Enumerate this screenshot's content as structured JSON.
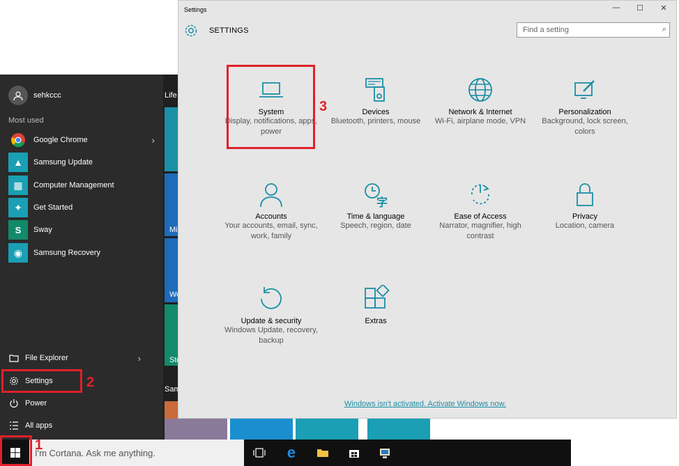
{
  "start_menu": {
    "user_name": "sehkccc",
    "most_used_label": "Most used",
    "life_label": "Life",
    "items": [
      {
        "label": "Google Chrome",
        "icon": "chrome-icon"
      },
      {
        "label": "Samsung Update",
        "icon": "samsung-update-icon"
      },
      {
        "label": "Computer Management",
        "icon": "computer-management-icon"
      },
      {
        "label": "Get Started",
        "icon": "lightbulb-icon"
      },
      {
        "label": "Sway",
        "icon": "sway-icon"
      },
      {
        "label": "Samsung Recovery",
        "icon": "samsung-recovery-icon"
      }
    ],
    "bottom": {
      "file_explorer": "File Explorer",
      "settings": "Settings",
      "power": "Power",
      "all_apps": "All apps"
    },
    "tile_labels": [
      "Mi",
      "We",
      "Sto",
      "Sam"
    ]
  },
  "taskbar": {
    "search_placeholder": "I'm Cortana. Ask me anything."
  },
  "settings_window": {
    "title": "Settings",
    "header": "SETTINGS",
    "find_placeholder": "Find a setting",
    "categories": [
      {
        "name": "System",
        "desc": "Display, notifications, apps, power",
        "icon": "laptop-icon"
      },
      {
        "name": "Devices",
        "desc": "Bluetooth, printers, mouse",
        "icon": "devices-icon"
      },
      {
        "name": "Network & Internet",
        "desc": "Wi-Fi, airplane mode, VPN",
        "icon": "globe-icon"
      },
      {
        "name": "Personalization",
        "desc": "Background, lock screen, colors",
        "icon": "paint-icon"
      },
      {
        "name": "Accounts",
        "desc": "Your accounts, email, sync, work, family",
        "icon": "person-icon"
      },
      {
        "name": "Time & language",
        "desc": "Speech, region, date",
        "icon": "time-language-icon"
      },
      {
        "name": "Ease of Access",
        "desc": "Narrator, magnifier, high contrast",
        "icon": "ease-of-access-icon"
      },
      {
        "name": "Privacy",
        "desc": "Location, camera",
        "icon": "lock-icon"
      },
      {
        "name": "Update & security",
        "desc": "Windows Update, recovery, backup",
        "icon": "update-icon"
      },
      {
        "name": "Extras",
        "desc": "",
        "icon": "extras-icon"
      }
    ],
    "activate_text": "Windows isn't activated. Activate Windows now."
  },
  "annotations": {
    "step1": "1",
    "step2": "2",
    "step3": "3"
  },
  "colors": {
    "accent": "#1a8fa6",
    "highlight": "#e0202a",
    "start_bg": "#2b2b2b"
  }
}
